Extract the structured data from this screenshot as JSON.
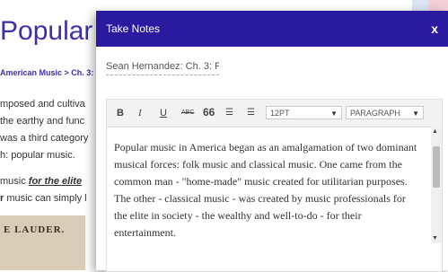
{
  "background": {
    "title": "Popular",
    "breadcrumb": "American Music > Ch. 3: Po",
    "lines": [
      "mposed and cultiva",
      " the earthy and func",
      "was a third category",
      "h: popular music."
    ],
    "line5_prefix": "music ",
    "line5_emph": "for the elite",
    "line6_bold": "r",
    "line6_rest": " music can simply l",
    "image_text": "E LAUDER."
  },
  "modal": {
    "title": "Take Notes",
    "close": "x",
    "note_title": "Sean Hernandez: Ch. 3: P",
    "toolbar": {
      "bold": "B",
      "italic": "I",
      "underline": "U",
      "strike": "ABC",
      "quote": "66",
      "ordered_list": "☰",
      "bullet_list": "☰",
      "font_size": "12PT",
      "block_format": "PARAGRAPH"
    },
    "body_text": "Popular music in America began as an amalgamation of two dominant musical forces: folk music and classical music. One came from the common man - \"home-made\" music created for utilitarian purposes. The other - classical music - was created by music professionals for the elite in society - the wealthy and well-to-do - for their entertainment."
  },
  "colors": {
    "header": "#2a1aa0",
    "title_link": "#3d2fa8"
  }
}
